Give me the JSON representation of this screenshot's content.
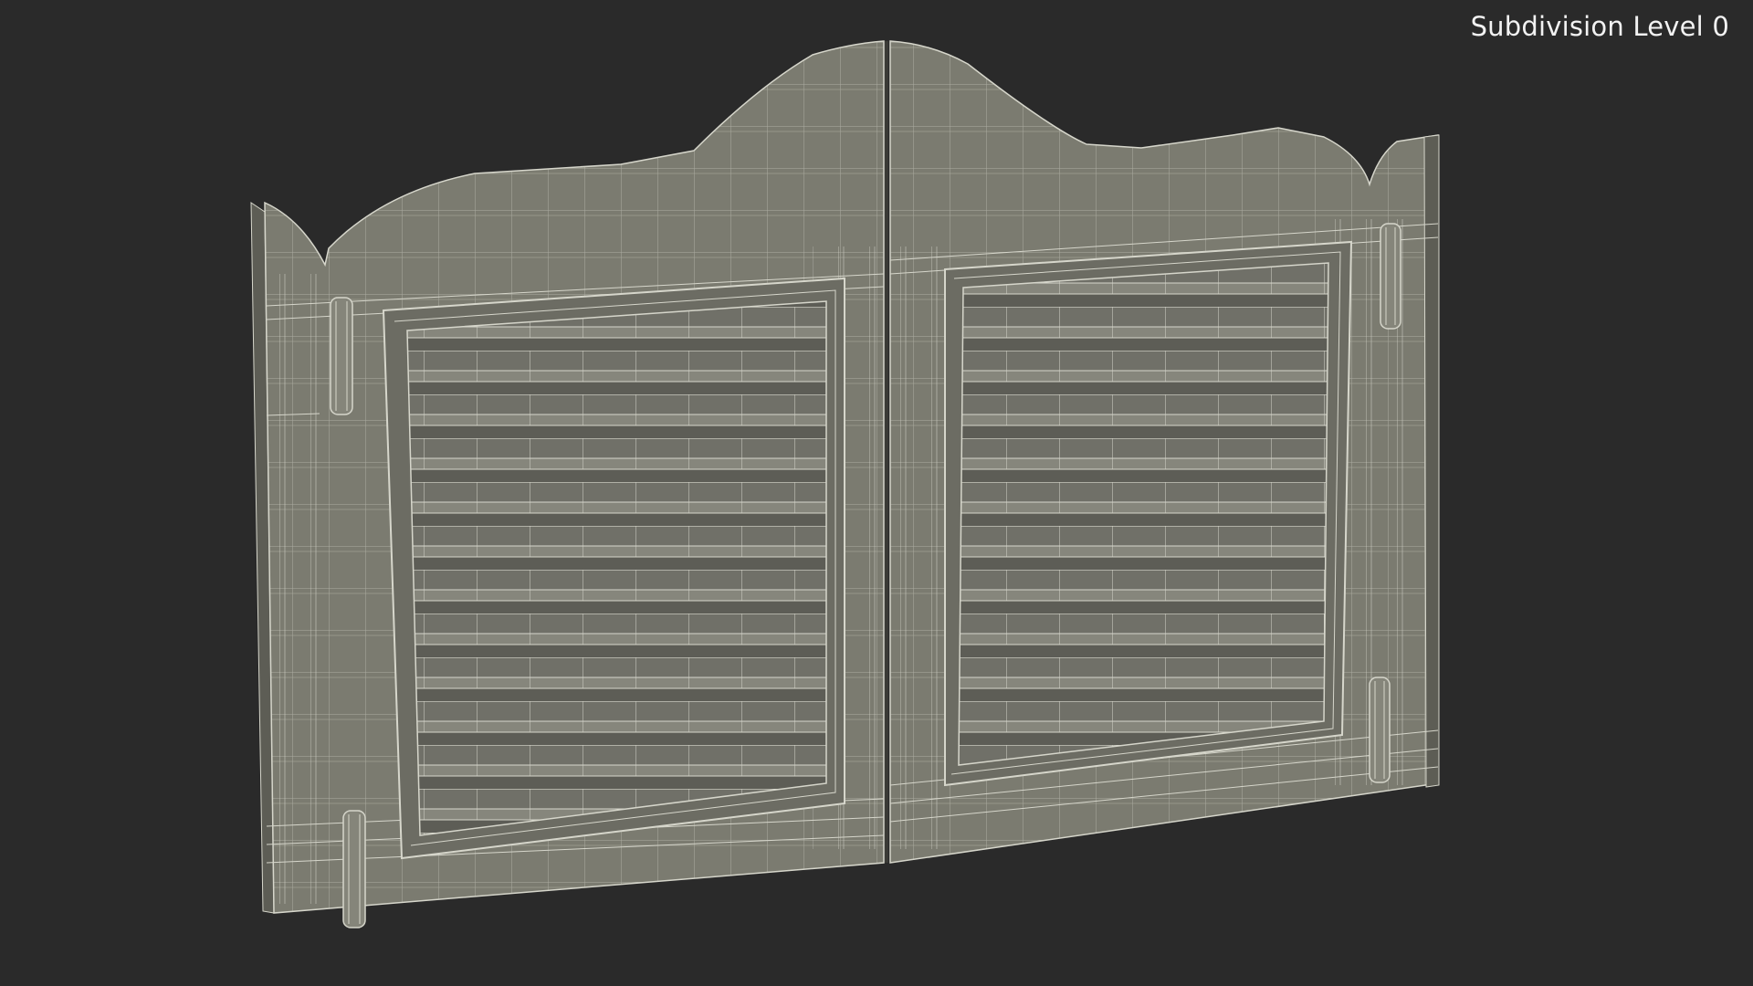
{
  "overlay": {
    "label": "Subdivision Level 0"
  },
  "scene": {
    "subject": "swinging saloon doors wireframe render",
    "background_color": "#2a2a2a",
    "surface_color": "#7b7b70",
    "surface_dark_color": "#62625a",
    "wire_color": "#d6d6cb"
  }
}
